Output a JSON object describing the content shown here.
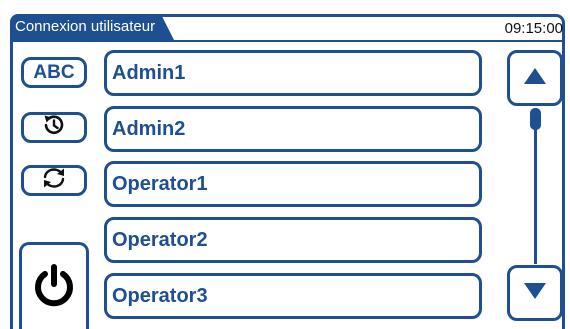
{
  "header": {
    "title": "Connexion utilisateur",
    "time": "09:15:00"
  },
  "side_buttons": {
    "abc_label": "ABC",
    "history_icon": "history-icon",
    "refresh_icon": "refresh-icon",
    "power_icon": "power-icon"
  },
  "users": [
    {
      "name": "Admin1"
    },
    {
      "name": "Admin2"
    },
    {
      "name": "Operator1"
    },
    {
      "name": "Operator2"
    },
    {
      "name": "Operator3"
    }
  ],
  "scroll": {
    "up_icon": "triangle-up-icon",
    "down_icon": "triangle-down-icon",
    "position": 0.0
  },
  "colors": {
    "accent": "#1d4f91",
    "background": "#ffffff"
  }
}
